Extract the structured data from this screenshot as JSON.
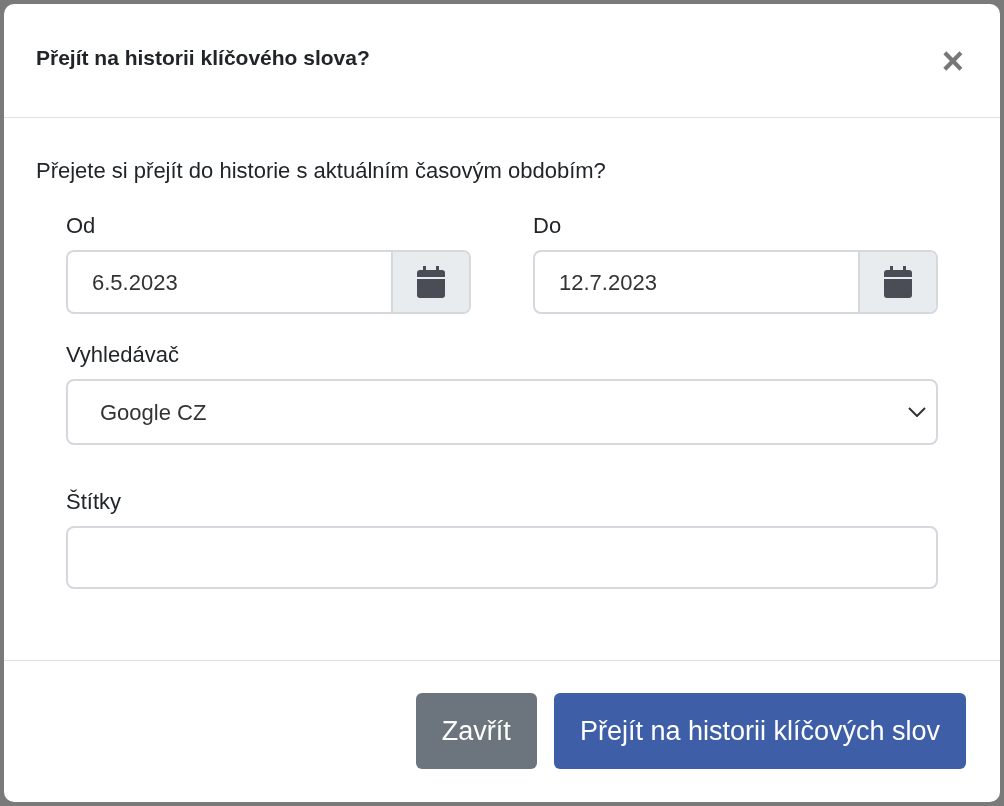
{
  "dialog": {
    "title": "Přejít na historii klíčového slova?",
    "close_icon": "×"
  },
  "question": "Přejete si přejít do historie s aktuálním časovým obdobím?",
  "date_fields": [
    {
      "label": "Od",
      "value": "6.5.2023"
    },
    {
      "label": "Do",
      "value": "12.7.2023"
    }
  ],
  "search_engine": {
    "label": "Vyhledávač",
    "value": "Google CZ"
  },
  "tags": {
    "label": "Štítky"
  },
  "buttons": [
    {
      "label": "Zavřít",
      "kind": "secondary"
    },
    {
      "label": "Přejít na historii klíčových slov",
      "kind": "primary"
    }
  ]
}
